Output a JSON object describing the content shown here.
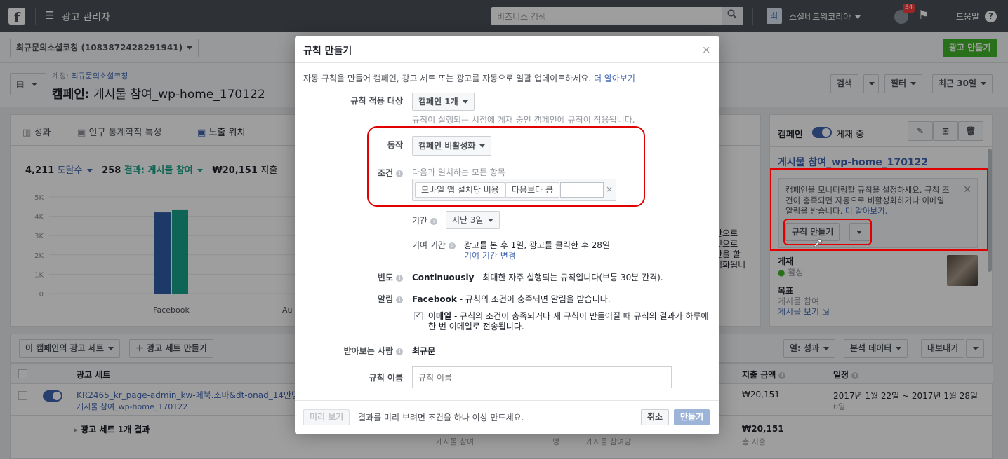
{
  "topbar": {
    "logo": "f",
    "menu_label": "광고 관리자",
    "search_placeholder": "비즈니스 검색",
    "account_initial": "최",
    "account_name": "소셜네트워코리아",
    "notification_count": "34",
    "help_label": "도움말"
  },
  "header": {
    "account_selector": "최규문의소셜코칭 (1083872428291941)",
    "create_ad_label": "광고 만들기",
    "breadcrumb_label": "계정:",
    "breadcrumb_account": "최규문의소셜코칭",
    "campaign_prefix": "캠페인:",
    "campaign_name": "게시물 참여_wp-home_170122",
    "search_label": "검색",
    "filter_label": "필터",
    "date_label": "최근 30일"
  },
  "insights": {
    "tabs": [
      {
        "label": "성과"
      },
      {
        "label": "인구 통계학적 특성"
      },
      {
        "label": "노출 위치"
      }
    ],
    "metrics": {
      "reach_value": "4,211",
      "reach_label": "도달수",
      "results_value": "258",
      "results_label": "결과: 게시물 참여",
      "spend_value": "₩20,151",
      "spend_label": "지출"
    },
    "y_ticks": [
      "5K",
      "4K",
      "3K",
      "2K",
      "1K",
      "0"
    ],
    "x_labels": [
      "Facebook",
      "Au"
    ],
    "side_text": [
      "반으로",
      "것으로",
      "산을 할",
      "적화됩니"
    ]
  },
  "chart_data": {
    "type": "bar",
    "categories": [
      "Facebook"
    ],
    "series": [
      {
        "values": [
          4200
        ]
      },
      {
        "values": [
          4350
        ]
      }
    ],
    "ylim": [
      0,
      5000
    ],
    "y_ticks": [
      "5K",
      "4K",
      "3K",
      "2K",
      "1K",
      "0"
    ],
    "colors": [
      "#2f5ca8",
      "#19a38a"
    ]
  },
  "right_panel": {
    "label": "캠페인",
    "status": "게재 중",
    "campaign_title": "게시물 참여_wp-home_170122",
    "tip_text": "캠페인을 모니터링할 규칙을 설정하세요. 규칙 조건이 충족되면 자동으로 비활성화하거나 이메일 알림을 받습니다.",
    "tip_link": "더 알아보기.",
    "create_rule_label": "규칙 만들기",
    "delivery_label": "게재",
    "delivery_status": "활성",
    "objective_label": "목표",
    "objective_value": "게시물 참여",
    "view_post_link": "게시물 보기"
  },
  "adsets_bar": {
    "adsets_dropdown": "이 캠페인의 광고 세트",
    "create_adset": "광고 세트 만들기",
    "columns_label": "열: 성과",
    "breakdown_label": "분석 데이터",
    "export_label": "내보내기"
  },
  "table": {
    "header_adset": "광고 세트",
    "header_spend": "지출 금액",
    "header_schedule": "일정",
    "row_name": "KR2465_kr_page-admin_kw-페북.소마&dt-onad_14만명",
    "row_sub": "게시물 참여_wp-home_170122",
    "row_spend": "₩20,151",
    "row_schedule": "2017년 1월 22일 ~ 2017년 1월 28일",
    "row_schedule_sub": "6일",
    "summary_label": "광고 세트 1개 결과",
    "summary_spend": "₩20,151",
    "summary_spend_sub": "총 지출",
    "summary_cells": [
      "게시물 참여",
      "명",
      "게시물 참여당"
    ]
  },
  "modal": {
    "title": "규칙 만들기",
    "intro": "자동 규칙을 만들어 캠페인, 광고 세트 또는 광고를 자동으로 일괄 업데이트하세요.",
    "intro_link": "더 알아보기",
    "apply_label": "규칙 적용 대상",
    "apply_value": "캠페인 1개",
    "apply_help": "규칙이 실행되는 시점에 게재 중인 캠페인에 규칙이 적용됩니다.",
    "action_label": "동작",
    "action_value": "캠페인 비활성화",
    "condition_label": "조건",
    "condition_help": "다음과 일치하는 모든 항목",
    "condition_metric": "모바일 앱 설치당 비용",
    "condition_operator": "다음보다 큼",
    "condition_value": "",
    "period_label": "기간",
    "period_value": "지난 3일",
    "attribution_label": "기여 기간",
    "attribution_value": "광고를 본 후 1일, 광고를 클릭한 후 28일",
    "attribution_link": "기여 기간 변경",
    "frequency_label": "빈도",
    "frequency_strong": "Continuously",
    "frequency_text": " - 최대한 자주 실행되는 규칙입니다(보통 30분 간격).",
    "notify_label": "알림",
    "notify_strong": "Facebook",
    "notify_text": " - 규칙의 조건이 충족되면 알림을 받습니다.",
    "email_strong": "이메일",
    "email_text": " - 규칙의 조건이 충족되거나 새 규칙이 만들어질 때 규칙의 결과가 하루에 한 번 이메일로 전송됩니다.",
    "subscriber_label": "받아보는 사람",
    "subscriber_value": "최규문",
    "name_label": "규칙 이름",
    "name_placeholder": "규칙 이름",
    "preview_label": "미리 보기",
    "preview_help": "결과를 미리 보려면 조건을 하나 이상 만드세요.",
    "cancel_label": "취소",
    "create_label": "만들기"
  }
}
